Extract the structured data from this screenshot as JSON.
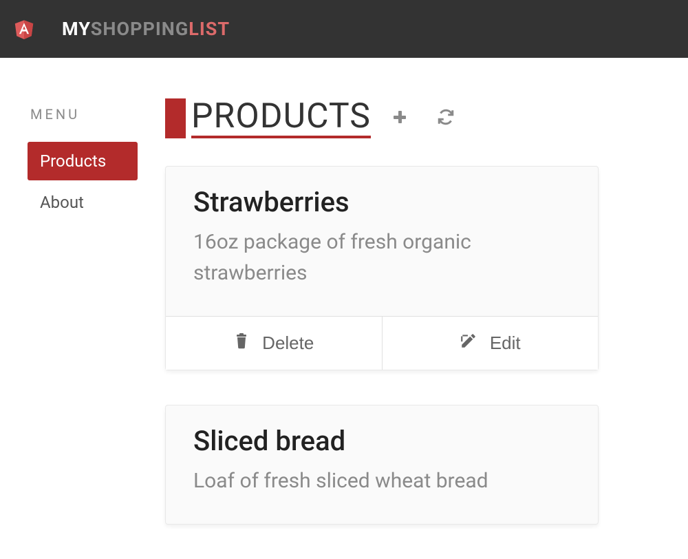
{
  "brand": {
    "part1": "MY",
    "part2": "SHOPPING",
    "part3": "LIST"
  },
  "sidebar": {
    "menu_label": "MENU",
    "items": [
      {
        "label": "Products",
        "active": true
      },
      {
        "label": "About",
        "active": false
      }
    ]
  },
  "page": {
    "title": "PRODUCTS"
  },
  "actions": {
    "delete_label": "Delete",
    "edit_label": "Edit"
  },
  "products": [
    {
      "title": "Strawberries",
      "description": "16oz package of fresh organic strawberries"
    },
    {
      "title": "Sliced bread",
      "description": "Loaf of fresh sliced wheat bread"
    }
  ]
}
